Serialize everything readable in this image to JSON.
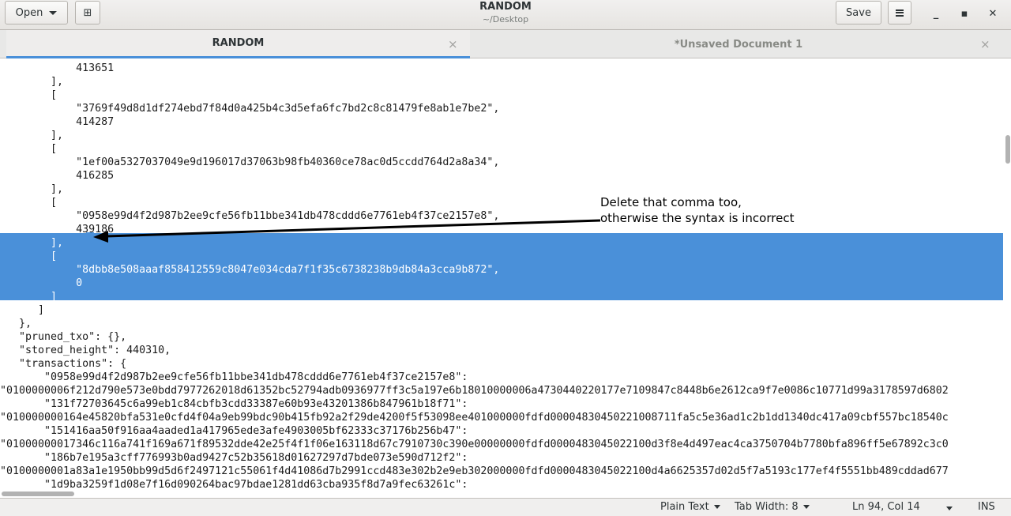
{
  "header": {
    "open_label": "Open",
    "save_label": "Save",
    "title": "RANDOM",
    "subtitle": "~/Desktop",
    "new_tab_glyph": "⊞",
    "minimize_glyph": "_",
    "maximize_glyph": "▪",
    "close_glyph": "✕"
  },
  "tabs": [
    {
      "label": "RANDOM",
      "active": true,
      "close_glyph": "×"
    },
    {
      "label": "*Unsaved Document 1",
      "active": false,
      "close_glyph": "×"
    }
  ],
  "editor": {
    "lines": [
      "            413651",
      "        ],",
      "        [",
      "            \"3769f49d8d1df274ebd7f84d0a425b4c3d5efa6fc7bd2c8c81479fe8ab1e7be2\",",
      "            414287",
      "        ],",
      "        [",
      "            \"1ef00a5327037049e9d196017d37063b98fb40360ce78ac0d5ccdd764d2a8a34\",",
      "            416285",
      "        ],",
      "        [",
      "            \"0958e99d4f2d987b2ee9cfe56fb11bbe341db478cddd6e7761eb4f37ce2157e8\",",
      "            439186",
      "        ],",
      "        [",
      "            \"8dbb8e508aaaf858412559c8047e034cda7f1f35c6738238b9db84a3cca9b872\",",
      "            0",
      "        ]",
      "      ]",
      "   },",
      "   \"pruned_txo\": {},",
      "   \"stored_height\": 440310,",
      "   \"transactions\": {",
      "       \"0958e99d4f2d987b2ee9cfe56fb11bbe341db478cddd6e7761eb4f37ce2157e8\":",
      "\"0100000006f212d790e573e0bdd7977262018d61352bc52794adb0936977ff3c5a197e6b18010000006a4730440220177e7109847c8448b6e2612ca9f7e0086c10771d99a3178597d6802",
      "       \"131f72703645c6a99eb1c84cbfb3cdd33387e60b93e43201386b847961b18f71\":",
      "\"010000000164e45820bfa531e0cfd4f04a9eb99bdc90b415fb92a2f29de4200f5f53098ee401000000fdfd00004830450221008711fa5c5e36ad1c2b1dd1340dc417a09cbf557bc18540c",
      "       \"151416aa50f916aa4aaded1a417965ede3afe4903005bf62333c37176b256b47\":",
      "\"01000000017346c116a741f169a671f89532dde42e25f4f1f06e163118d67c7910730c390e00000000fdfd0000483045022100d3f8e4d497eac4ca3750704b7780bfa896ff5e67892c3c0",
      "       \"186b7e195a3cff776993b0ad9427c52b35618d01627297d7bde073e590d712f2\":",
      "\"0100000001a83a1e1950bb99d5d6f2497121c55061f4d41086d7b2991ccd483e302b2e9eb302000000fdfd0000483045022100d4a6625357d02d5f7a5193c177ef4f5551bb489cddad677",
      "       \"1d9ba3259f1d08e7f16d090264bac97bdae1281dd63cba935f8d7a9fec63261c\":"
    ]
  },
  "annotation": {
    "line1": "Delete that comma too,",
    "line2": "otherwise the syntax is incorrect"
  },
  "statusbar": {
    "language": "Plain Text",
    "tab_width": "Tab Width: 8",
    "position": "Ln 94, Col 14",
    "mode": "INS"
  },
  "colors": {
    "selection": "#4a90d9",
    "accent": "#4a90d9"
  }
}
